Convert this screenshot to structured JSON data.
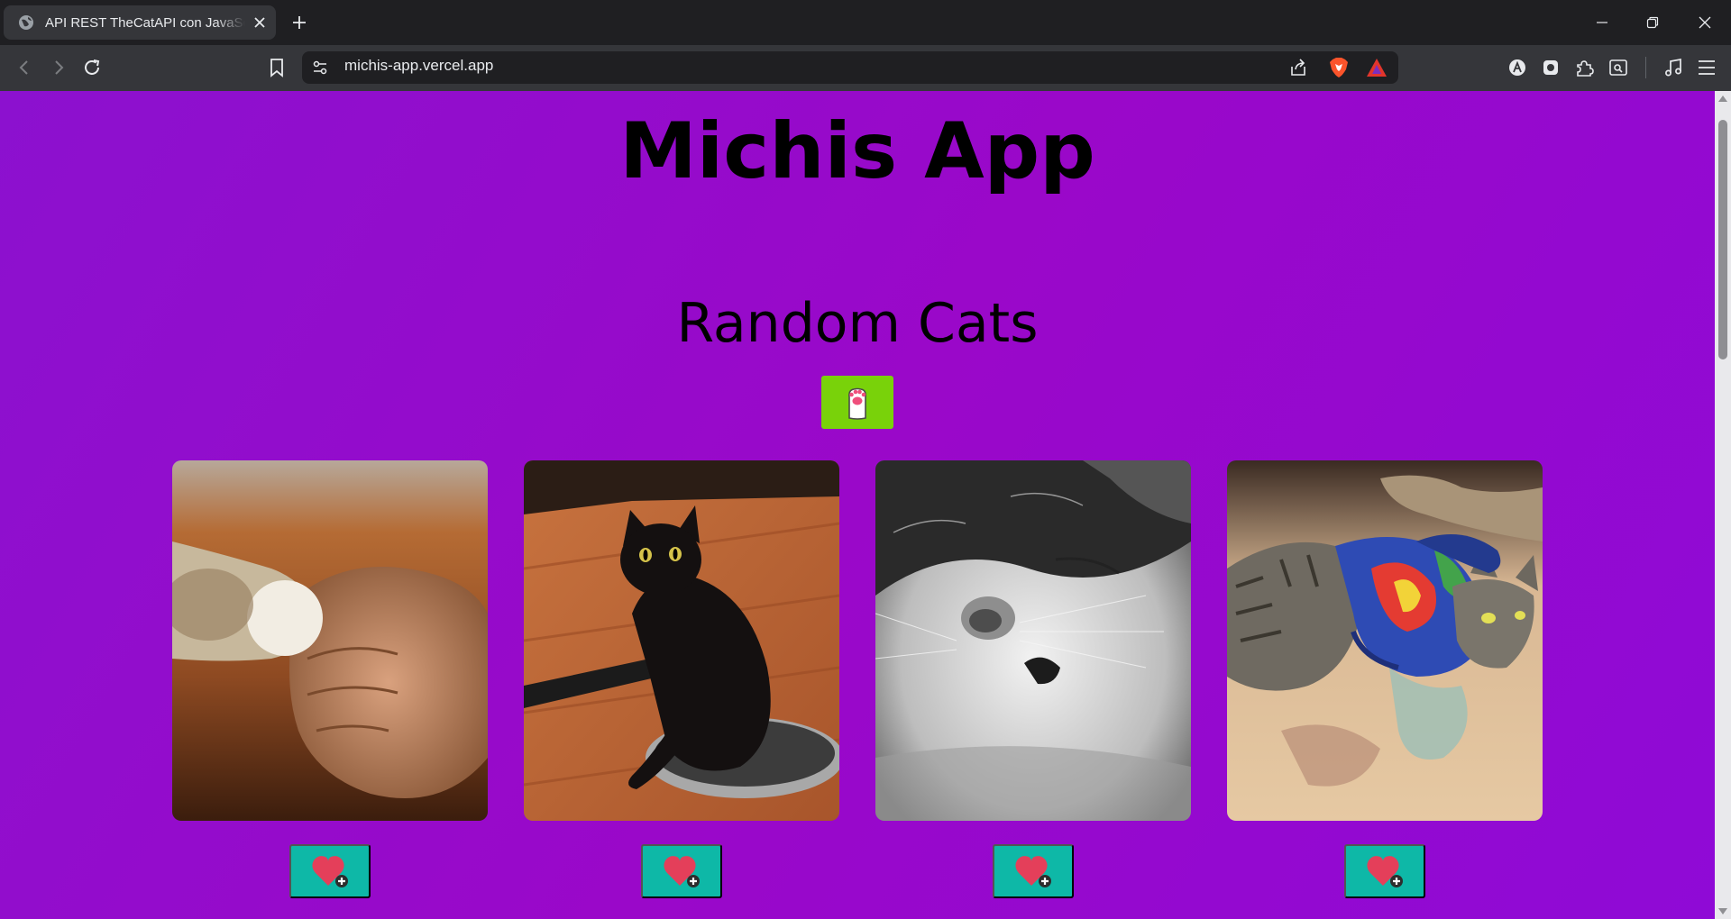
{
  "browser": {
    "tab_title": "API REST TheCatAPI con JavaScript",
    "url": "michis-app.vercel.app"
  },
  "page": {
    "title": "Michis App",
    "section_title": "Random Cats"
  },
  "colors": {
    "background_start": "#8c11cf",
    "background_end": "#8f0ad6",
    "reload_button": "#79d20a",
    "favorite_button": "#0eb8a7",
    "heart": "#e43f5a"
  },
  "cats": [
    {
      "icon": "cat-paw-fist-bump-photo",
      "action": "heart-plus-icon"
    },
    {
      "icon": "black-cat-in-pan-photo",
      "action": "heart-plus-icon"
    },
    {
      "icon": "sleeping-bw-cat-photo",
      "action": "heart-plus-icon"
    },
    {
      "icon": "tabby-cat-in-tie-dye-photo",
      "action": "heart-plus-icon"
    }
  ]
}
